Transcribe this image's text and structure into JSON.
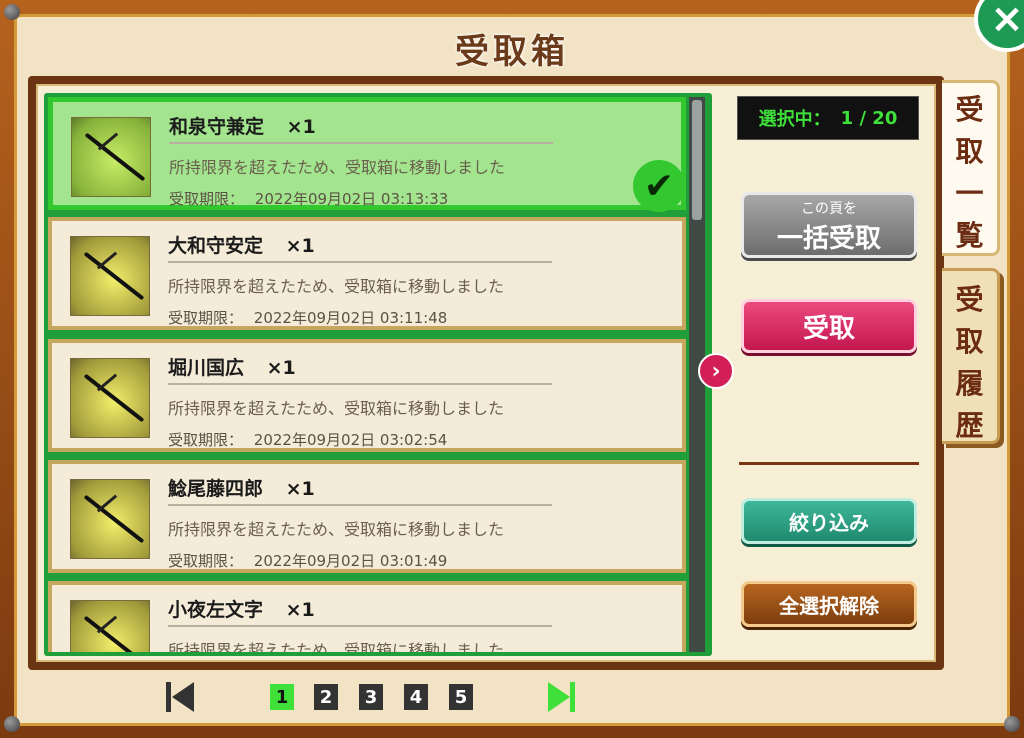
{
  "window": {
    "title": "受取箱",
    "close_icon": "×"
  },
  "selection": {
    "label": "選択中：",
    "count": "1 / 20"
  },
  "items": [
    {
      "name": "和泉守兼定",
      "qty": "×1",
      "reason": "所持限界を超えたため、受取箱に移動しました",
      "deadline_label": "受取期限：",
      "deadline": "2022年09月02日 03:13:33",
      "selected": true
    },
    {
      "name": "大和守安定",
      "qty": "×1",
      "reason": "所持限界を超えたため、受取箱に移動しました",
      "deadline_label": "受取期限：",
      "deadline": "2022年09月02日 03:11:48",
      "selected": false
    },
    {
      "name": "堀川国広",
      "qty": "×1",
      "reason": "所持限界を超えたため、受取箱に移動しました",
      "deadline_label": "受取期限：",
      "deadline": "2022年09月02日 03:02:54",
      "selected": false
    },
    {
      "name": "鯰尾藤四郎",
      "qty": "×1",
      "reason": "所持限界を超えたため、受取箱に移動しました",
      "deadline_label": "受取期限：",
      "deadline": "2022年09月02日 03:01:49",
      "selected": false
    },
    {
      "name": "小夜左文字",
      "qty": "×1",
      "reason": "所持限界を超えたため、受取箱に移動しました",
      "deadline_label": "",
      "deadline": "",
      "selected": false
    }
  ],
  "buttons": {
    "bulk_sub": "この頁を",
    "bulk_main": "一括受取",
    "receive": "受取",
    "filter": "絞り込み",
    "deselect_all": "全選択解除",
    "expand_arrow": "›"
  },
  "tabs": {
    "list_chars": [
      "受",
      "取",
      "一",
      "覧"
    ],
    "history_chars": [
      "受",
      "取",
      "履",
      "歴"
    ]
  },
  "pager": {
    "pages": [
      "1",
      "2",
      "3",
      "4",
      "5"
    ],
    "current": "1"
  },
  "colors": {
    "accent_green": "#33c82f",
    "receive_pink": "#d21f58",
    "filter_teal": "#2a9e80",
    "deselect_brown": "#9a4f16"
  }
}
